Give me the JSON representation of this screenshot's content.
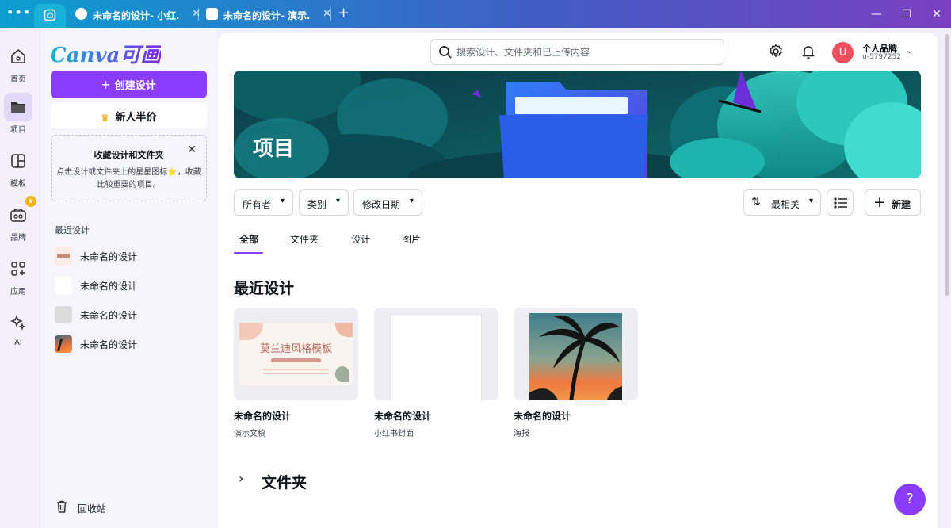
{
  "titlebar": {
    "tabs": [
      {
        "label": "未命名的设计- 小红…",
        "close": "✕"
      },
      {
        "label": "未命名的设计- 演示…",
        "close": "✕"
      }
    ],
    "add": "+",
    "controls": {
      "minimize": "—",
      "maximize": "☐",
      "close": "✕"
    }
  },
  "rail": {
    "items": [
      {
        "label": "首页"
      },
      {
        "label": "项目"
      },
      {
        "label": "模板"
      },
      {
        "label": "品牌"
      },
      {
        "label": "应用"
      },
      {
        "label": "AI"
      }
    ]
  },
  "panel": {
    "logo": "Canva可画",
    "create_label": "创建设计",
    "newbie_label": "新人半价",
    "tip": {
      "title": "收藏设计和文件夹",
      "body": "点击设计或文件夹上的星星图标⭐，收藏比较重要的项目。"
    },
    "recent_heading": "最近设计",
    "recent_items": [
      {
        "label": "未命名的设计"
      },
      {
        "label": "未命名的设计"
      },
      {
        "label": "未命名的设计"
      },
      {
        "label": "未命名的设计"
      }
    ],
    "trash_label": "回收站"
  },
  "header": {
    "search_placeholder": "搜索设计、文件夹和已上传内容",
    "avatar_letter": "U",
    "brand_name": "个人品牌",
    "brand_id": "u-5797252"
  },
  "hero": {
    "title": "项目"
  },
  "filters": {
    "owner": "所有者",
    "category": "类别",
    "modified": "修改日期",
    "sort": "最相关",
    "new": "新建"
  },
  "content_tabs": [
    "全部",
    "文件夹",
    "设计",
    "图片"
  ],
  "recent_section": {
    "title": "最近设计",
    "cards": [
      {
        "title": "未命名的设计",
        "type": "演示文稿",
        "thumb_text": "莫兰迪风格模板"
      },
      {
        "title": "未命名的设计",
        "type": "小红书封面"
      },
      {
        "title": "未命名的设计",
        "type": "海报"
      }
    ]
  },
  "folders_section": {
    "title": "文件夹"
  },
  "help": "?",
  "colors": {
    "accent": "#8b3dff",
    "avatar": "#ee4f5d"
  }
}
